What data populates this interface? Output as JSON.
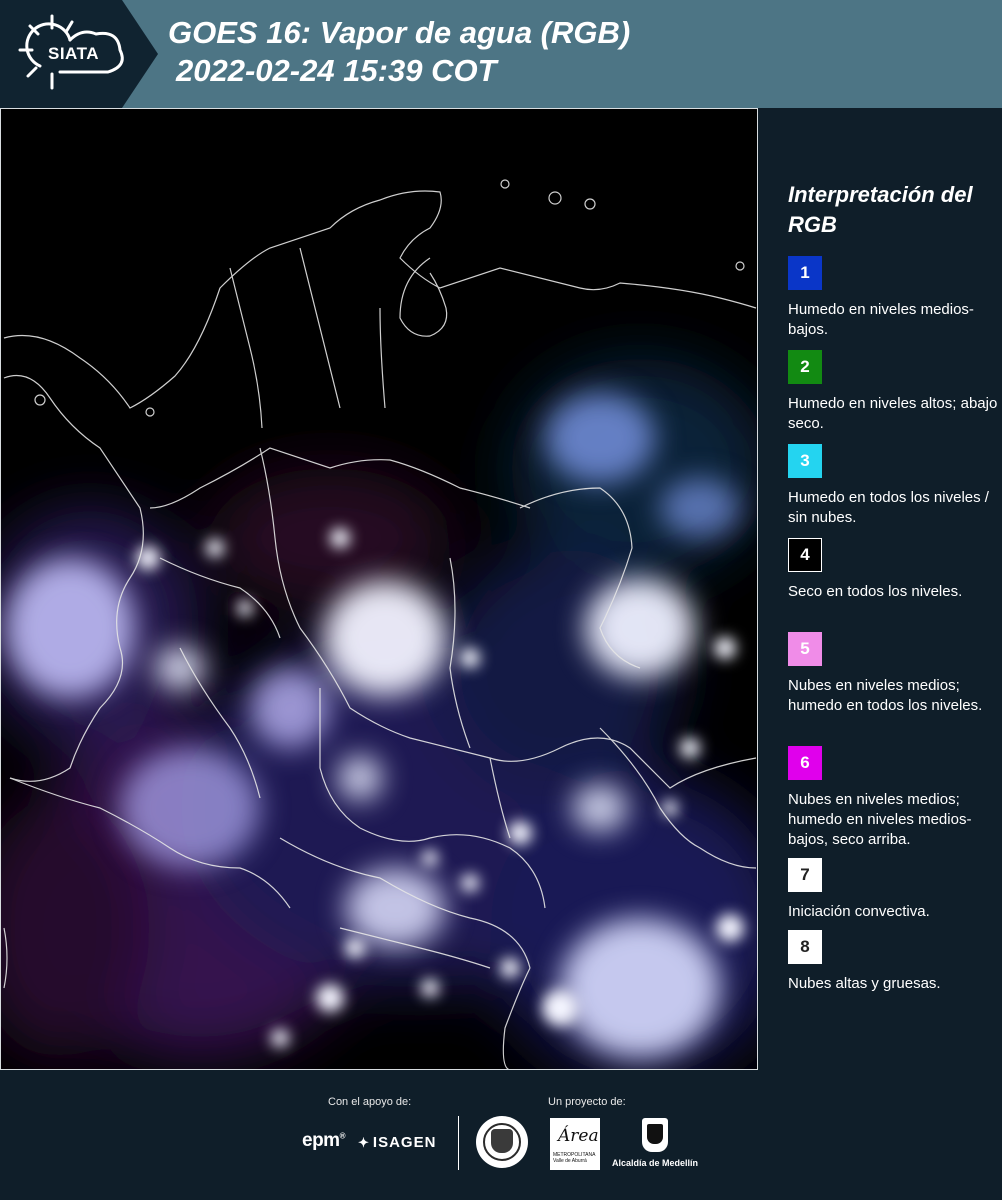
{
  "header": {
    "title": "GOES 16: Vapor de agua (RGB)",
    "subtitle": "2022-02-24 15:39 COT",
    "logo": "SIATA",
    "background": "#4d7585"
  },
  "legend": {
    "title": "Interpretación del RGB",
    "items": [
      {
        "number": "1",
        "color": "#0a36c8",
        "description": "Humedo en niveles medios-bajos."
      },
      {
        "number": "2",
        "color": "#128a12",
        "description": "Humedo en niveles altos; abajo seco."
      },
      {
        "number": "3",
        "color": "#24d4f0",
        "description": "Humedo en todos los niveles / sin nubes."
      },
      {
        "number": "4",
        "color": "#000000",
        "description": "Seco en todos los niveles."
      },
      {
        "number": "5",
        "color": "#f08ce8",
        "description": "Nubes en niveles medios; humedo en todos los niveles."
      },
      {
        "number": "6",
        "color": "#e000ec",
        "description": "Nubes en niveles medios; humedo en niveles medios-bajos, seco arriba."
      },
      {
        "number": "7",
        "color": "#ffffff",
        "description": "Iniciación convectiva."
      },
      {
        "number": "8",
        "color": "#ffffff",
        "description": "Nubes altas y gruesas."
      }
    ]
  },
  "footer": {
    "support_label": "Con el apoyo de:",
    "project_label": "Un proyecto de:",
    "sponsors": [
      "epm",
      "ISAGEN"
    ],
    "partners": [
      "Área Metropolitana Valle de Aburrá",
      "Alcaldía de Medellín"
    ]
  },
  "icons": [
    "siata-sun-logo",
    "epm-logo",
    "isagen-logo",
    "medellin-seal-logo",
    "area-metropolitana-logo",
    "alcaldia-emblem-logo"
  ]
}
